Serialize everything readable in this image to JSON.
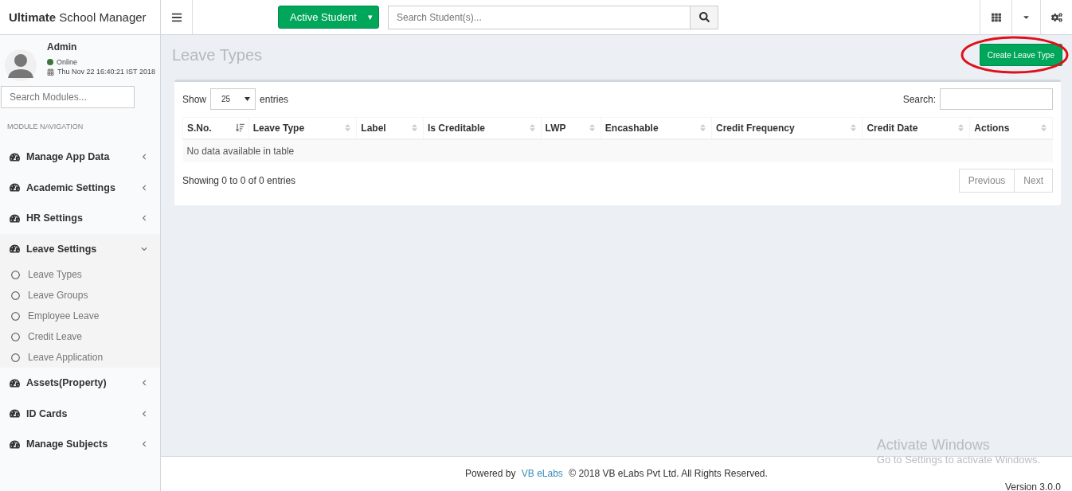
{
  "header": {
    "logo": "**Ultimate** School Manager",
    "student_filter": {
      "label": "Active Student",
      "caret": "▾"
    },
    "search": {
      "placeholder": "Search Student(s)..."
    }
  },
  "sidebar": {
    "user": {
      "name": "Admin",
      "status": "Online",
      "online": true,
      "datetime": "Thu Nov 22 16:40:21 IST 2018"
    },
    "search": {
      "placeholder": "Search Modules..."
    },
    "heading": "MODULE NAVIGATION",
    "items": [
      {
        "label": "Manage App Data",
        "expanded": false
      },
      {
        "label": "Academic Settings",
        "expanded": false
      },
      {
        "label": "HR Settings",
        "expanded": false
      },
      {
        "label": "Leave Settings",
        "expanded": true,
        "children": [
          {
            "label": "Leave Types"
          },
          {
            "label": "Leave Groups"
          },
          {
            "label": "Employee Leave"
          },
          {
            "label": "Credit Leave"
          },
          {
            "label": "Leave Application"
          }
        ]
      },
      {
        "label": "Assets(Property)",
        "expanded": false
      },
      {
        "label": "ID Cards",
        "expanded": false
      },
      {
        "label": "Manage Subjects",
        "expanded": false
      }
    ]
  },
  "page": {
    "title": "Leave Types",
    "create_button": {
      "label": "Create Leave Type",
      "circled": true
    }
  },
  "table": {
    "show_label": "Show",
    "page_size": "25",
    "entries_label": "entries",
    "search_label": "Search:",
    "columns": [
      {
        "label": "S.No.",
        "sorted": true
      },
      {
        "label": "Leave Type",
        "sorted": false
      },
      {
        "label": "Label",
        "sorted": false
      },
      {
        "label": "Is Creditable",
        "sorted": false
      },
      {
        "label": "LWP",
        "sorted": false
      },
      {
        "label": "Encashable",
        "sorted": false
      },
      {
        "label": "Credit Frequency",
        "sorted": false
      },
      {
        "label": "Credit Date",
        "sorted": false
      },
      {
        "label": "Actions",
        "sorted": false
      }
    ],
    "empty_message": "No data available in table",
    "info": "Showing 0 to 0 of 0 entries",
    "pagination": [
      "Previous",
      "Next"
    ]
  },
  "footer": {
    "powered_by": "Powered by",
    "link": "VB eLabs",
    "copyright": "© 2018 VB eLabs Pvt Ltd. All Rights Reserved.",
    "version": "Version 3.0.0"
  },
  "windows_notice": {
    "title": "Activate Windows",
    "text": "Go to Settings to activate Windows."
  }
}
